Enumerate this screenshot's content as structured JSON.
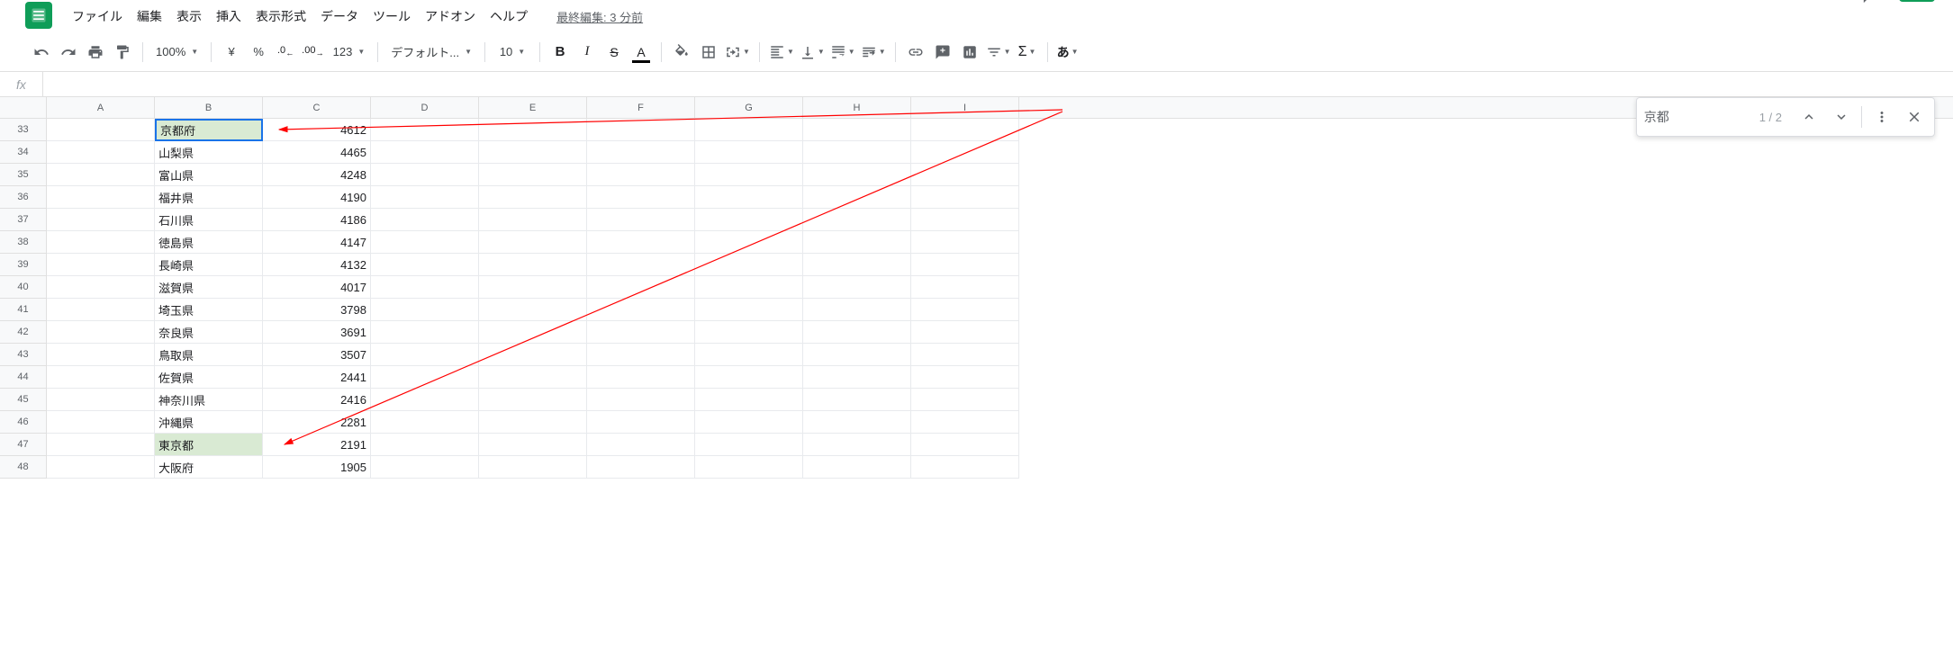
{
  "menu": {
    "items": [
      "ファイル",
      "編集",
      "表示",
      "挿入",
      "表示形式",
      "データ",
      "ツール",
      "アドオン",
      "ヘルプ"
    ],
    "last_edit": "最終編集: 3 分前"
  },
  "toolbar": {
    "zoom": "100%",
    "currency": "¥",
    "percent": "%",
    "dec_dec": ".0",
    "inc_dec": ".00",
    "more_fmt": "123",
    "font": "デフォルト...",
    "font_size": "10",
    "ime": "あ"
  },
  "find": {
    "query": "京都",
    "count": "1 / 2"
  },
  "columns": [
    "A",
    "B",
    "C",
    "D",
    "E",
    "F",
    "G",
    "H",
    "I"
  ],
  "rows": [
    {
      "num": "33",
      "b": "京都府",
      "c": "4612",
      "highlight": "selected"
    },
    {
      "num": "34",
      "b": "山梨県",
      "c": "4465"
    },
    {
      "num": "35",
      "b": "富山県",
      "c": "4248"
    },
    {
      "num": "36",
      "b": "福井県",
      "c": "4190"
    },
    {
      "num": "37",
      "b": "石川県",
      "c": "4186"
    },
    {
      "num": "38",
      "b": "徳島県",
      "c": "4147"
    },
    {
      "num": "39",
      "b": "長崎県",
      "c": "4132"
    },
    {
      "num": "40",
      "b": "滋賀県",
      "c": "4017"
    },
    {
      "num": "41",
      "b": "埼玉県",
      "c": "3798"
    },
    {
      "num": "42",
      "b": "奈良県",
      "c": "3691"
    },
    {
      "num": "43",
      "b": "鳥取県",
      "c": "3507"
    },
    {
      "num": "44",
      "b": "佐賀県",
      "c": "2441"
    },
    {
      "num": "45",
      "b": "神奈川県",
      "c": "2416"
    },
    {
      "num": "46",
      "b": "沖縄県",
      "c": "2281"
    },
    {
      "num": "47",
      "b": "東京都",
      "c": "2191",
      "highlight": "highlighted"
    },
    {
      "num": "48",
      "b": "大阪府",
      "c": "1905"
    }
  ]
}
